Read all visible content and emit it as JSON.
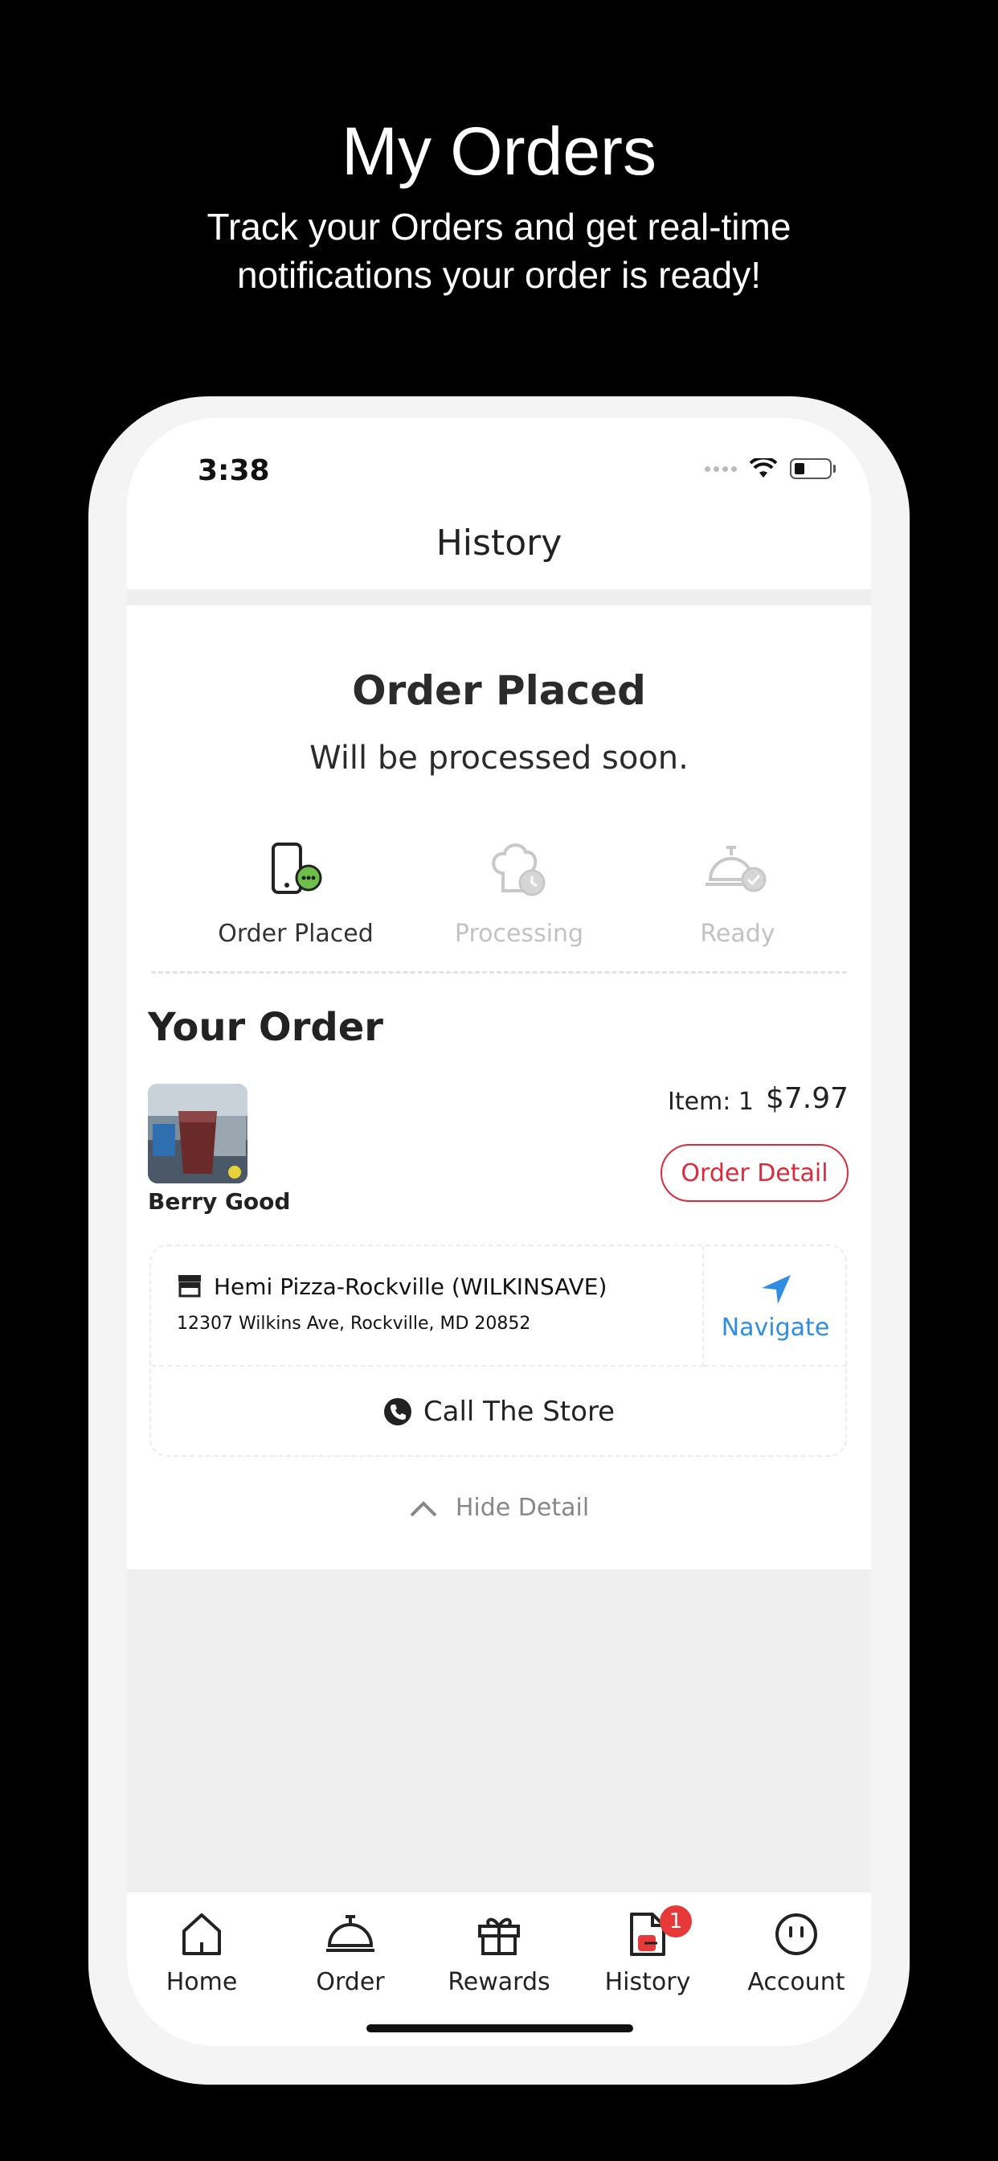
{
  "promo": {
    "title": "My Orders",
    "subtitle": "Track your Orders and get real-time notifications your order is ready!"
  },
  "status_bar": {
    "time": "3:38"
  },
  "header": {
    "title": "History"
  },
  "order_status": {
    "heading": "Order Placed",
    "subtext": "Will be processed soon.",
    "steps": [
      {
        "label": "Order Placed",
        "state": "active",
        "icon": "phone-chat-icon"
      },
      {
        "label": "Processing",
        "state": "inactive",
        "icon": "chef-hat-clock-icon"
      },
      {
        "label": "Ready",
        "state": "inactive",
        "icon": "cloche-check-icon"
      }
    ],
    "progress_color": "#7ed321"
  },
  "your_order": {
    "heading": "Your Order",
    "product_name": "Berry Good",
    "item_count": "Item: 1",
    "total": "$7.97",
    "order_detail_label": "Order Detail"
  },
  "store": {
    "name": "Hemi Pizza-Rockville (WILKINSAVE)",
    "address": "12307 Wilkins Ave, Rockville, MD 20852",
    "navigate_label": "Navigate",
    "call_label": "Call The Store"
  },
  "toggle": {
    "label": "Hide Detail"
  },
  "tab_bar": {
    "items": [
      {
        "label": "Home",
        "icon": "home-icon"
      },
      {
        "label": "Order",
        "icon": "cloche-icon"
      },
      {
        "label": "Rewards",
        "icon": "gift-icon"
      },
      {
        "label": "History",
        "icon": "receipt-icon",
        "badge": "1"
      },
      {
        "label": "Account",
        "icon": "account-icon"
      }
    ]
  },
  "colors": {
    "accent_red": "#d92b3a",
    "navigate_blue": "#2f8de4",
    "badge_red": "#e63a3a"
  }
}
